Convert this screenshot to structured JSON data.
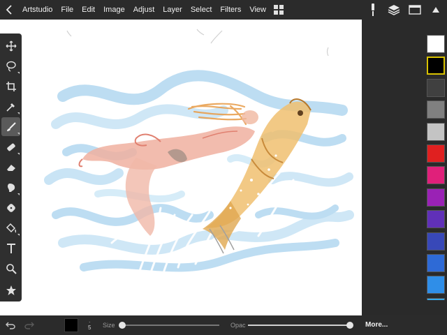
{
  "menubar": {
    "app_name": "Artstudio",
    "items": [
      "File",
      "Edit",
      "Image",
      "Adjust",
      "Layer",
      "Select",
      "Filters",
      "View"
    ]
  },
  "top_right_icons": [
    "brush-settings-icon",
    "layers-icon",
    "panels-icon",
    "collapse-arrow-icon"
  ],
  "tools": [
    {
      "name": "move-tool",
      "icon": "move-icon"
    },
    {
      "name": "lasso-tool",
      "icon": "lasso-icon"
    },
    {
      "name": "crop-tool",
      "icon": "crop-icon"
    },
    {
      "name": "eyedropper-tool",
      "icon": "eyedropper-icon"
    },
    {
      "name": "brush-tool",
      "icon": "brush-icon",
      "active": true
    },
    {
      "name": "smudge-tool",
      "icon": "smudge-icon"
    },
    {
      "name": "eraser-tool",
      "icon": "eraser-icon"
    },
    {
      "name": "blur-tool",
      "icon": "blur-icon"
    },
    {
      "name": "clone-tool",
      "icon": "clone-icon"
    },
    {
      "name": "fill-tool",
      "icon": "fill-bucket-icon"
    },
    {
      "name": "text-tool",
      "icon": "text-icon"
    },
    {
      "name": "zoom-tool",
      "icon": "magnifier-icon"
    },
    {
      "name": "favorites-tool",
      "icon": "star-icon"
    }
  ],
  "palette": {
    "colors": [
      "#ffffff",
      "#000000",
      "#404040",
      "#808080",
      "#c4c4c4",
      "#e02020",
      "#e0207a",
      "#9a22b5",
      "#6030b8",
      "#3848b8",
      "#2e6ad6",
      "#2f8ee8",
      "#38a8e8"
    ],
    "selected_index": 1
  },
  "bottombar": {
    "undo_icon": "undo-icon",
    "redo_icon": "redo-icon",
    "current_color": "#000000",
    "brush_size_indicator": "5",
    "size_label": "Size",
    "size_value": 0.02,
    "opacity_label": "Opac",
    "opacity_value": 1.0,
    "more_label": "More..."
  }
}
